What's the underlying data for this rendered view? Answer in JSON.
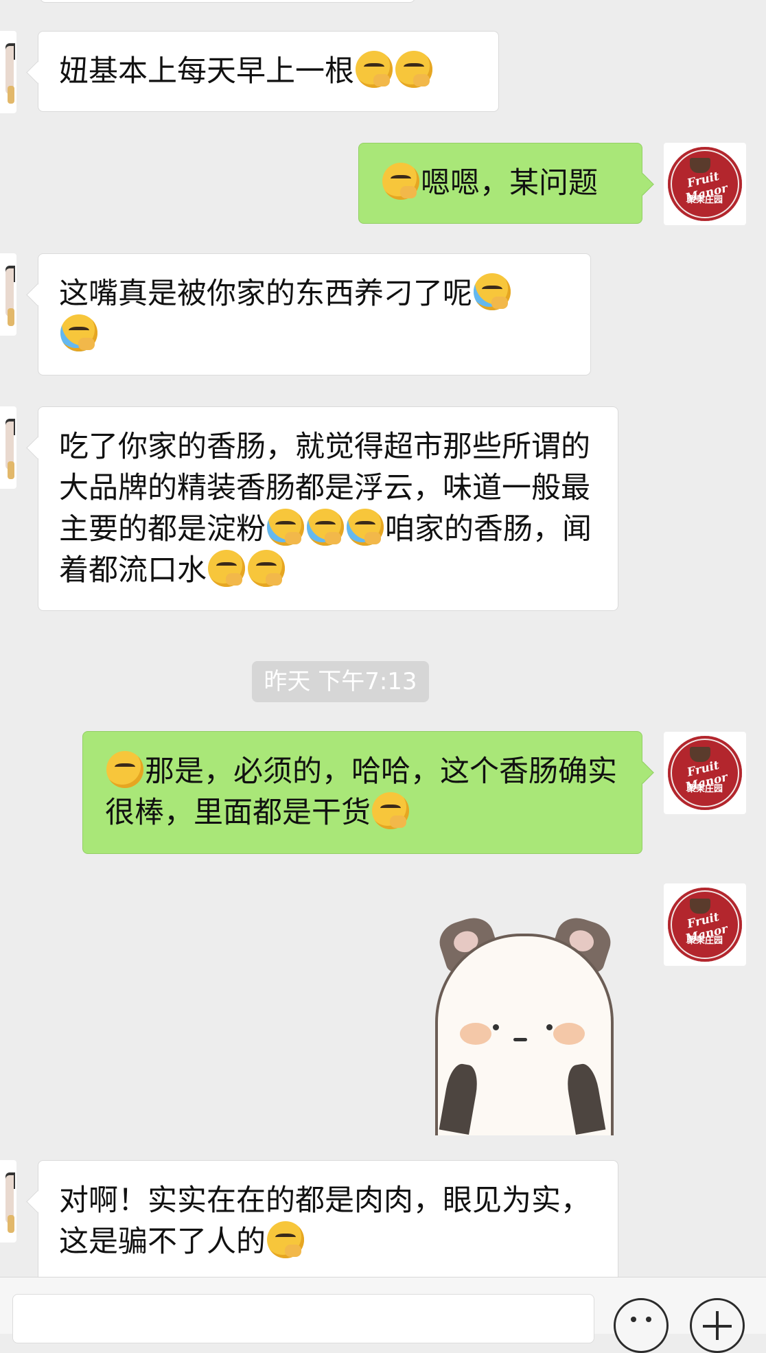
{
  "messages": [
    {
      "side": "in",
      "text": "妞基本上每天早上一根",
      "emojis": [
        "smirk-hand-emoji",
        "smirk-hand-emoji"
      ]
    },
    {
      "side": "out",
      "text": "嗯嗯，某问题",
      "emojis_before": [
        "smirk-hand-emoji"
      ]
    },
    {
      "side": "in",
      "text": "这嘴真是被你家的东西养刁了呢",
      "emojis": [
        "facepalm-cry-emoji",
        "facepalm-cry-emoji"
      ]
    },
    {
      "side": "in",
      "text_a": "吃了你家的香肠，就觉得超市那些所谓的大品牌的精装香肠都是浮云，味道一般最主要的都是淀粉",
      "text_b": "咱家的香肠，闻着都流口水",
      "emojis": [
        "facepalm-cry-emoji",
        "facepalm-cry-emoji",
        "facepalm-cry-emoji",
        "pleading-hand-emoji",
        "pleading-hand-emoji"
      ]
    },
    {
      "side": "out",
      "text": "那是，必须的，哈哈，这个香肠确实很棒，里面都是干货",
      "emojis": [
        "tongue-squint-emoji",
        "hand-over-mouth-emoji"
      ]
    },
    {
      "side": "out",
      "type": "sticker",
      "sticker": "panda-sticker"
    },
    {
      "side": "in",
      "text": "对啊！实实在在的都是肉肉，眼见为实，这是骗不了人的",
      "emojis": [
        "hand-over-mouth-emoji"
      ]
    }
  ],
  "timestamp": "昨天 下午7:13",
  "brand": {
    "logo_text": "Fruit Manor",
    "logo_cn": "聚果庄园"
  },
  "colors": {
    "background": "#ededed",
    "bubble_out": "#a9e778",
    "bubble_in": "#ffffff",
    "brand_red": "#b3262d"
  }
}
